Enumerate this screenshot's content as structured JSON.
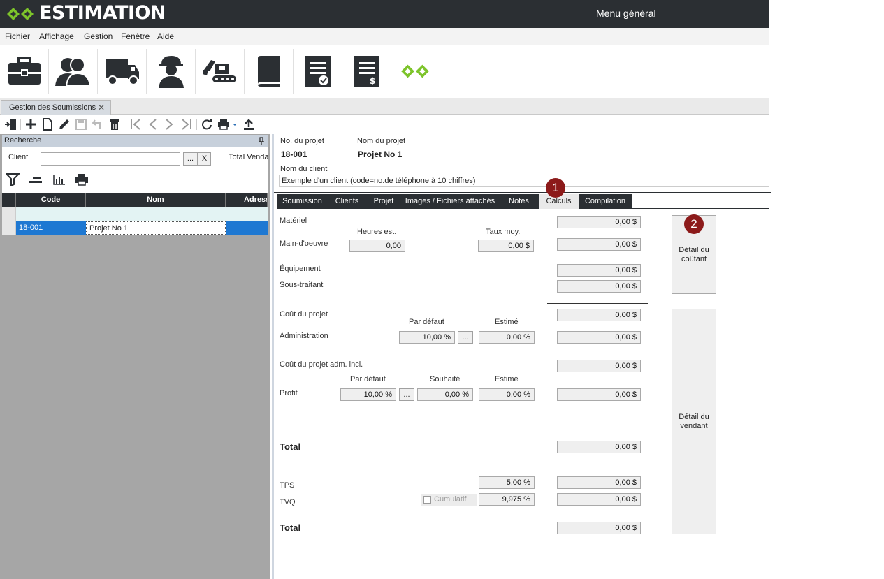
{
  "app": {
    "title": "ESTIMATION",
    "menu_general": "Menu général"
  },
  "menu": [
    "Fichier",
    "Affichage",
    "Gestion",
    "Fenêtre",
    "Aide"
  ],
  "ribbon_icons": [
    "briefcase-icon",
    "contacts-icon",
    "truck-icon",
    "worker-icon",
    "excavator-icon",
    "book-icon",
    "document-check-icon",
    "invoice-icon",
    "logo-icon"
  ],
  "doc_tab": {
    "label": "Gestion des Soumissions",
    "close": "✕"
  },
  "search": {
    "header": "Recherche",
    "client_label": "Client",
    "client_value": "",
    "browse_label": "...",
    "clear_label": "X",
    "total_label": "Total Vendant"
  },
  "grid": {
    "columns": [
      "Code",
      "Nom",
      "Adresse"
    ],
    "rows": [
      {
        "code": "18-001",
        "nom": "Projet No 1",
        "adresse": ""
      }
    ]
  },
  "project": {
    "no_label": "No. du projet",
    "no_value": "18-001",
    "name_label": "Nom du projet",
    "name_value": "Projet No 1",
    "client_label": "Nom du client",
    "client_value": "Exemple d'un client (code=no.de téléphone à 10 chiffres)"
  },
  "tabs": [
    "Soumission",
    "Clients",
    "Projet",
    "Images / Fichiers attachés",
    "Notes",
    "Calculs",
    "Compilation"
  ],
  "active_tab": "Calculs",
  "badges": {
    "one": "1",
    "two": "2"
  },
  "calc": {
    "materiel_label": "Matériel",
    "materiel": "0,00 $",
    "heures_label": "Heures est.",
    "taux_label": "Taux moy.",
    "mo_label": "Main-d'oeuvre",
    "mo_heures": "0,00",
    "mo_taux": "0,00 $",
    "mo_total": "0,00 $",
    "equip_label": "Équipement",
    "equip": "0,00 $",
    "sous_label": "Sous-traitant",
    "sous": "0,00 $",
    "cout_label": "Coût du projet",
    "cout": "0,00 $",
    "par_defaut_label": "Par défaut",
    "estime_label": "Estimé",
    "souhaite_label": "Souhaité",
    "admin_label": "Administration",
    "admin_defaut": "10,00 %",
    "admin_estime": "0,00 %",
    "admin_total": "0,00 $",
    "cout_adm_label": "Coût du projet adm. incl.",
    "cout_adm": "0,00 $",
    "profit_label": "Profit",
    "profit_defaut": "10,00 %",
    "profit_souhaite": "0,00 %",
    "profit_estime": "0,00 %",
    "profit_total": "0,00 $",
    "total_label": "Total",
    "total": "0,00 $",
    "tps_label": "TPS",
    "tps_rate": "5,00 %",
    "tps": "0,00 $",
    "tvq_label": "TVQ",
    "cumulatif_label": "Cumulatif",
    "tvq_rate": "9,975 %",
    "tvq": "0,00 $",
    "grand_total_label": "Total",
    "grand_total": "0,00 $",
    "dots": "...",
    "detail_cout_label": "Détail du coûtant",
    "detail_vendant_label": "Détail du vendant"
  }
}
